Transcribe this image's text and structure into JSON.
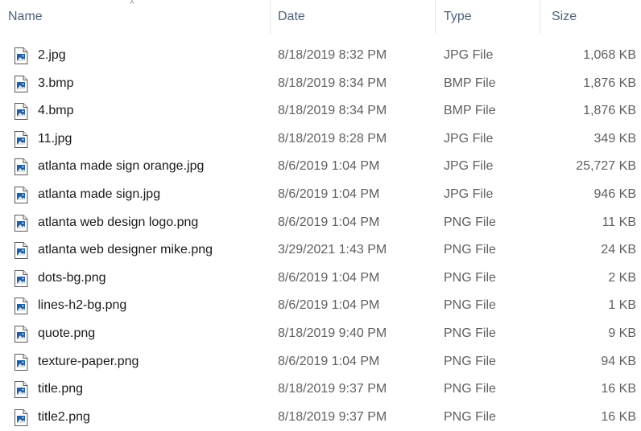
{
  "columns": {
    "name": "Name",
    "date": "Date",
    "type": "Type",
    "size": "Size"
  },
  "files": [
    {
      "name": "2.jpg",
      "date": "8/18/2019 8:32 PM",
      "type": "JPG File",
      "size": "1,068 KB"
    },
    {
      "name": "3.bmp",
      "date": "8/18/2019 8:34 PM",
      "type": "BMP File",
      "size": "1,876 KB"
    },
    {
      "name": "4.bmp",
      "date": "8/18/2019 8:34 PM",
      "type": "BMP File",
      "size": "1,876 KB"
    },
    {
      "name": "11.jpg",
      "date": "8/18/2019 8:28 PM",
      "type": "JPG File",
      "size": "349 KB"
    },
    {
      "name": "atlanta made sign orange.jpg",
      "date": "8/6/2019 1:04 PM",
      "type": "JPG File",
      "size": "25,727 KB"
    },
    {
      "name": "atlanta made sign.jpg",
      "date": "8/6/2019 1:04 PM",
      "type": "JPG File",
      "size": "946 KB"
    },
    {
      "name": "atlanta web design logo.png",
      "date": "8/6/2019 1:04 PM",
      "type": "PNG File",
      "size": "11 KB"
    },
    {
      "name": "atlanta web designer mike.png",
      "date": "3/29/2021 1:43 PM",
      "type": "PNG File",
      "size": "24 KB"
    },
    {
      "name": "dots-bg.png",
      "date": "8/6/2019 1:04 PM",
      "type": "PNG File",
      "size": "2 KB"
    },
    {
      "name": "lines-h2-bg.png",
      "date": "8/6/2019 1:04 PM",
      "type": "PNG File",
      "size": "1 KB"
    },
    {
      "name": "quote.png",
      "date": "8/18/2019 9:40 PM",
      "type": "PNG File",
      "size": "9 KB"
    },
    {
      "name": "texture-paper.png",
      "date": "8/6/2019 1:04 PM",
      "type": "PNG File",
      "size": "94 KB"
    },
    {
      "name": "title.png",
      "date": "8/18/2019 9:37 PM",
      "type": "PNG File",
      "size": "16 KB"
    },
    {
      "name": "title2.png",
      "date": "8/18/2019 9:37 PM",
      "type": "PNG File",
      "size": "16 KB"
    }
  ],
  "icons": {
    "file": "image-file-icon",
    "sort": "sort-indicator-icon"
  },
  "colors": {
    "header_text": "#4c607a",
    "name_text": "#1a1a1a",
    "detail_text": "#606060",
    "icon_blue": "#1e5fa8"
  }
}
